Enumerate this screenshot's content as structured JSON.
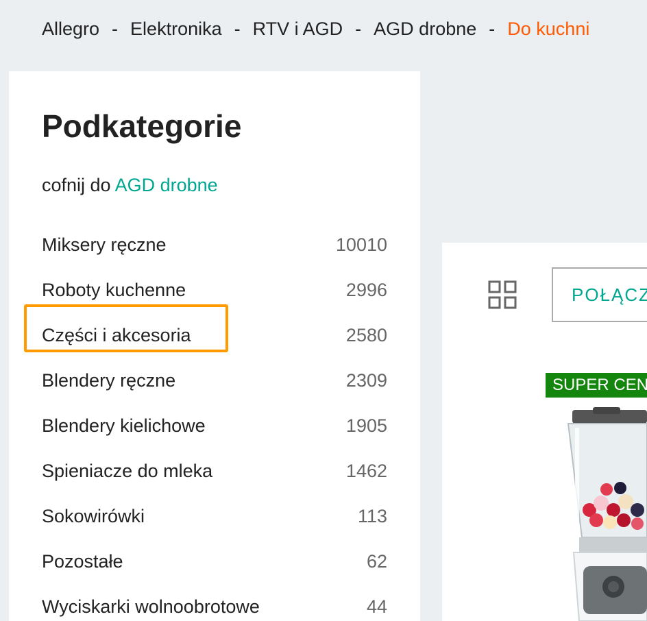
{
  "breadcrumb": {
    "items": [
      "Allegro",
      "Elektronika",
      "RTV i AGD",
      "AGD drobne"
    ],
    "current": "Do kuchni",
    "separator": "-"
  },
  "sidebar": {
    "title": "Podkategorie",
    "back_prefix": "cofnij do",
    "back_link": "AGD drobne",
    "categories": [
      {
        "name": "Miksery ręczne",
        "count": "10010"
      },
      {
        "name": "Roboty kuchenne",
        "count": "2996"
      },
      {
        "name": "Części i akcesoria",
        "count": "2580"
      },
      {
        "name": "Blendery ręczne",
        "count": "2309"
      },
      {
        "name": "Blendery kielichowe",
        "count": "1905"
      },
      {
        "name": "Spieniacze do mleka",
        "count": "1462"
      },
      {
        "name": "Sokowirówki",
        "count": "113"
      },
      {
        "name": "Pozostałe",
        "count": "62"
      },
      {
        "name": "Wyciskarki wolnoobrotowe",
        "count": "44"
      }
    ]
  },
  "listing": {
    "view_icon": "grid-view-icon",
    "connect_label": "POŁĄCZ",
    "badge": "SUPER CENA"
  },
  "colors": {
    "accent": "#00a790",
    "breadcrumb_current": "#ff5a00",
    "highlight": "#ff9a00",
    "badge_bg": "#14860e"
  }
}
